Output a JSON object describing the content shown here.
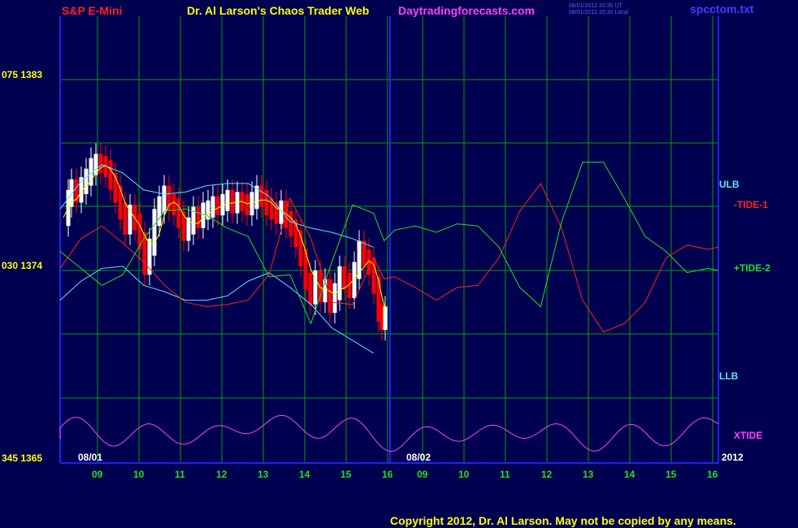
{
  "header": {
    "instrument": "S&P E-Mini",
    "title": "Dr. Al Larson's Chaos Trader Web",
    "site": "Daytradingforecasts.com",
    "stamp1": "08/01/2012 20:30 UT",
    "stamp2": "08/01/2012 15:30 Local",
    "file": "spcctom.txt"
  },
  "footer": {
    "copyright": "Copyright 2012, Dr. Al Larson. May not be copied by any means."
  },
  "colors": {
    "background": "#000050",
    "grid": "#00a000",
    "frame": "#2020ff",
    "up_bar": "#ffffff",
    "down_bar": "#ff0000",
    "band": "#60e0ff",
    "tide1": "#ff2020",
    "tide2": "#20e020",
    "xtide": "#ff40ff",
    "yellow": "#ffff00"
  },
  "chart_data": {
    "type": "line",
    "y_labels": [
      "075 1383",
      "030 1374",
      "345 1365"
    ],
    "ylim": [
      1365,
      1383
    ],
    "x_ticks": [
      {
        "label": "09",
        "color": "#20e020"
      },
      {
        "label": "10",
        "color": "#20e020"
      },
      {
        "label": "11",
        "color": "#20e020"
      },
      {
        "label": "12",
        "color": "#20e020"
      },
      {
        "label": "13",
        "color": "#20e020"
      },
      {
        "label": "14",
        "color": "#20e020"
      },
      {
        "label": "15",
        "color": "#20e020"
      },
      {
        "label": "16",
        "color": "#20e020"
      },
      {
        "label": "09",
        "color": "#20e020"
      },
      {
        "label": "10",
        "color": "#20e020"
      },
      {
        "label": "11",
        "color": "#20e020"
      },
      {
        "label": "12",
        "color": "#20e020"
      },
      {
        "label": "13",
        "color": "#20e020"
      },
      {
        "label": "14",
        "color": "#20e020"
      },
      {
        "label": "15",
        "color": "#20e020"
      },
      {
        "label": "16",
        "color": "#20e020"
      }
    ],
    "date_labels": [
      "08/01",
      "08/02",
      "2012"
    ],
    "series_labels": [
      {
        "name": "ULB",
        "color": "#60e0ff"
      },
      {
        "name": "-TIDE-1",
        "color": "#ff2020"
      },
      {
        "name": "+TIDE-2",
        "color": "#20e020"
      },
      {
        "name": "LLB",
        "color": "#60e0ff"
      },
      {
        "name": "XTIDE",
        "color": "#ff40ff"
      }
    ],
    "hours": [
      8.5,
      9,
      9.5,
      10,
      10.5,
      11,
      11.5,
      12,
      12.5,
      13,
      13.5,
      14,
      14.5,
      15,
      15.5,
      16,
      16.25,
      16.5,
      17,
      17.5,
      18,
      18.5,
      19,
      19.5,
      20,
      20.5,
      21,
      21.5,
      22,
      22.5,
      23,
      23.5,
      24,
      24.25
    ],
    "series": [
      {
        "name": "ULB",
        "values": [
          1376.9,
          1378.2,
          1379.0,
          1378.6,
          1377.8,
          1377.6,
          1377.7,
          1378.0,
          1378.1,
          1378.1,
          1377.5,
          1376.3,
          1376.0,
          1375.8,
          1375.5,
          1375.1
        ]
      },
      {
        "name": "LLB",
        "values": [
          1372.6,
          1373.5,
          1374.1,
          1374.2,
          1373.3,
          1373.0,
          1372.6,
          1372.6,
          1372.8,
          1373.5,
          1373.9,
          1373.2,
          1372.4,
          1371.3,
          1370.7,
          1370.1
        ]
      },
      {
        "name": "-TIDE-1",
        "values": [
          1374.1,
          1375.5,
          1376.1,
          1375.3,
          1374.4,
          1373.3,
          1372.5,
          1372.3,
          1372.4,
          1372.6,
          1373.8,
          1377.4,
          1375.5,
          1372.5,
          1372.4,
          1374.6,
          1373.6,
          1373.7,
          1373.2,
          1372.6,
          1373.2,
          1373.3,
          1374.6,
          1376.8,
          1378.1,
          1376.0,
          1372.6,
          1371.1,
          1371.5,
          1372.5,
          1374.6,
          1375.2,
          1375.0,
          1375.1
        ]
      },
      {
        "name": "+TIDE-2",
        "values": [
          1374.9,
          1374.1,
          1373.3,
          1373.8,
          1375.5,
          1376.8,
          1376.9,
          1376.6,
          1376.0,
          1375.6,
          1373.7,
          1373.8,
          1371.5,
          1374.4,
          1377.1,
          1376.7,
          1375.4,
          1375.9,
          1376.1,
          1375.8,
          1376.2,
          1376.1,
          1375.1,
          1373.2,
          1372.3,
          1376.3,
          1379.1,
          1379.1,
          1377.4,
          1375.6,
          1374.9,
          1373.9,
          1374.1,
          1374.0
        ]
      }
    ]
  }
}
